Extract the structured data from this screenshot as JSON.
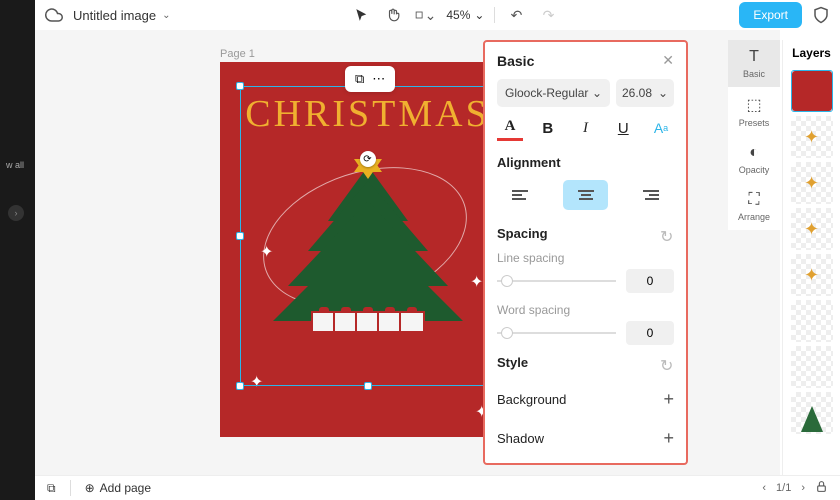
{
  "topbar": {
    "title": "Untitled image",
    "zoom": "45%",
    "export_label": "Export"
  },
  "left_strip": {
    "label": "w all"
  },
  "page_label": "Page 1",
  "canvas_text": "CHRISTMAS",
  "panel": {
    "title": "Basic",
    "font": "Gloock-Regular",
    "size": "26.08",
    "alignment_title": "Alignment",
    "spacing_title": "Spacing",
    "line_label": "Line spacing",
    "line_value": "0",
    "word_label": "Word spacing",
    "word_value": "0",
    "style_title": "Style",
    "background_label": "Background",
    "shadow_label": "Shadow"
  },
  "right_tabs": {
    "basic": "Basic",
    "presets": "Presets",
    "opacity": "Opacity",
    "arrange": "Arrange"
  },
  "layers_title": "Layers",
  "bottombar": {
    "add_page": "Add page",
    "page_indicator": "1/1"
  }
}
